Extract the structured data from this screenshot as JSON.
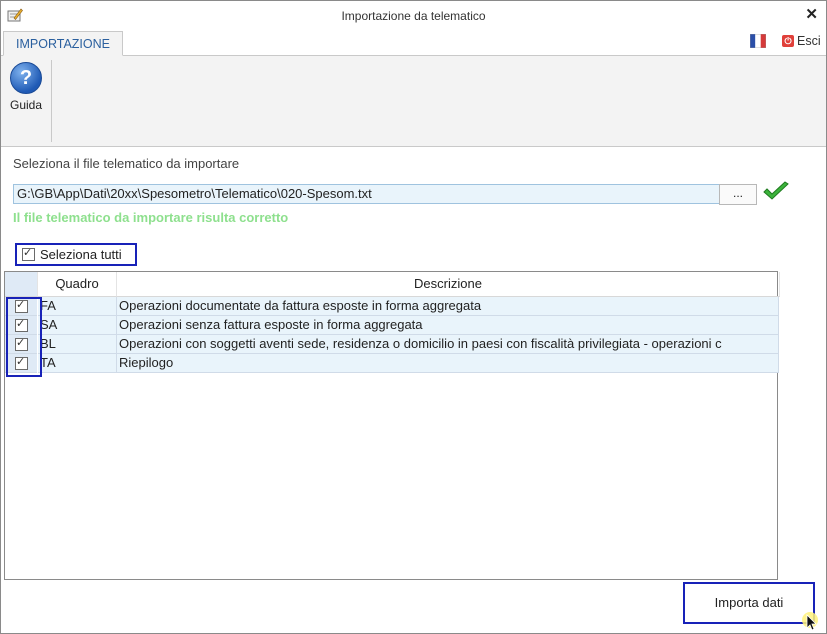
{
  "window": {
    "title": "Importazione da telematico",
    "close_glyph": "✕"
  },
  "tabs": [
    {
      "label": "IMPORTAZIONE"
    }
  ],
  "header_right": {
    "flag_icon": "french-flag-icon",
    "exit_label": "Esci",
    "exit_icon_glyph": "⏻"
  },
  "ribbon": {
    "help_label": "Guida",
    "help_glyph": "?"
  },
  "form": {
    "prompt": "Seleziona il file telematico da importare",
    "file_path": "G:\\GB\\App\\Dati\\20xx\\Spesometro\\Telematico\\020-Spesom.txt",
    "browse_label": "...",
    "status_message": "Il file telematico da importare risulta corretto"
  },
  "select_all": {
    "label": "Seleziona tutti",
    "checked": true
  },
  "table": {
    "columns": [
      "Quadro",
      "Descrizione"
    ],
    "rows": [
      {
        "quadro": "FA",
        "descrizione": "Operazioni documentate da fattura esposte in forma aggregata",
        "checked": true
      },
      {
        "quadro": "SA",
        "descrizione": "Operazioni senza fattura esposte in forma aggregata",
        "checked": true
      },
      {
        "quadro": "BL",
        "descrizione": "Operazioni con soggetti aventi sede, residenza o domicilio in paesi con fiscalità privilegiata - operazioni c",
        "checked": true
      },
      {
        "quadro": "TA",
        "descrizione": "Riepilogo",
        "checked": true
      }
    ]
  },
  "footer": {
    "import_label": "Importa dati"
  },
  "colors": {
    "accent_blue": "#1822b8",
    "tab_text": "#2a5f9e",
    "status_green": "#8ee08e",
    "row_bg": "#e9f4fb"
  }
}
